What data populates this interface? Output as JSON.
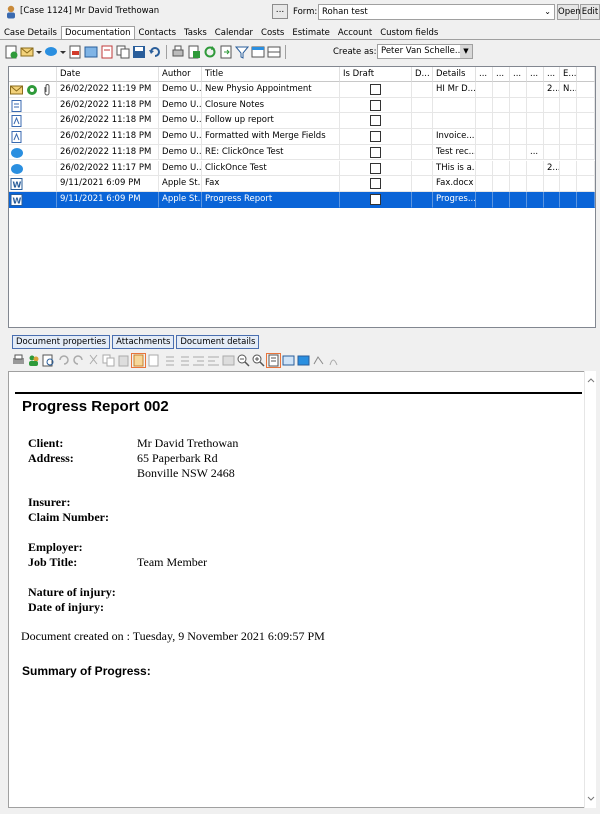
{
  "window": {
    "case_title": "[Case 1124] Mr David Trethowan",
    "more_label": "...",
    "form_label": "Form:",
    "form_value": "Rohan test",
    "open_label": "Open",
    "edit_label": "Edit"
  },
  "tabs": [
    "Case Details",
    "Documentation",
    "Contacts",
    "Tasks",
    "Calendar",
    "Costs",
    "Estimate",
    "Account",
    "Custom fields"
  ],
  "toolbar": {
    "create_as_label": "Create as:",
    "create_as_value": "Peter Van Schelle..."
  },
  "grid": {
    "headers": [
      "Date",
      "Author",
      "Title",
      "Is Draft",
      "D...",
      "Details",
      "...",
      "...",
      "...",
      "...",
      "...",
      "E..."
    ],
    "rows": [
      {
        "date": "26/02/2022 11:19 PM",
        "author": "Demo U...",
        "title": "New Physio Appointment",
        "details": "HI Mr D...",
        "c1": "",
        "c2": "",
        "c3": "",
        "c4": "",
        "c5": "2...",
        "c6": "N...",
        "selected": false
      },
      {
        "date": "26/02/2022 11:18 PM",
        "author": "Demo U...",
        "title": "Closure Notes",
        "details": "",
        "c1": "",
        "c2": "",
        "c3": "",
        "c4": "",
        "c5": "",
        "c6": "",
        "selected": false
      },
      {
        "date": "26/02/2022 11:18 PM",
        "author": "Demo U...",
        "title": "Follow up report",
        "details": "",
        "c1": "",
        "c2": "",
        "c3": "",
        "c4": "",
        "c5": "",
        "c6": "",
        "selected": false
      },
      {
        "date": "26/02/2022 11:18 PM",
        "author": "Demo U...",
        "title": "Formatted with Merge Fields",
        "details": "Invoice...",
        "c1": "",
        "c2": "",
        "c3": "",
        "c4": "",
        "c5": "",
        "c6": "",
        "selected": false
      },
      {
        "date": "26/02/2022 11:18 PM",
        "author": "Demo U...",
        "title": "RE: ClickOnce Test",
        "details": "Test rec...",
        "c1": "",
        "c2": "",
        "c3": "",
        "c4": "...",
        "c5": "",
        "c6": "",
        "selected": false
      },
      {
        "date": "26/02/2022 11:17 PM",
        "author": "Demo U...",
        "title": "ClickOnce Test",
        "details": "THis is a...",
        "c1": "",
        "c2": "",
        "c3": "",
        "c4": "",
        "c5": "2...",
        "c6": "",
        "selected": false
      },
      {
        "date": "9/11/2021 6:09 PM",
        "author": "Apple St...",
        "title": "Fax",
        "details": "Fax.docx",
        "c1": "",
        "c2": "",
        "c3": "",
        "c4": "",
        "c5": "",
        "c6": "",
        "selected": false
      },
      {
        "date": "9/11/2021 6:09 PM",
        "author": "Apple St...",
        "title": "Progress Report",
        "details": "Progres...",
        "c1": "",
        "c2": "",
        "c3": "",
        "c4": "",
        "c5": "",
        "c6": "",
        "selected": true
      }
    ]
  },
  "doc_tabs": [
    "Document properties",
    "Attachments",
    "Document details"
  ],
  "document": {
    "title": "Progress Report 002",
    "client_label": "Client:",
    "client_value": "Mr David Trethowan",
    "address_label": "Address:",
    "address_line1": "65 Paperbark Rd",
    "address_line2": "Bonville NSW 2468",
    "insurer_label": "Insurer:",
    "claim_label": "Claim Number:",
    "employer_label": "Employer:",
    "jobtitle_label": "Job Title:",
    "jobtitle_value": "Team Member",
    "injury_label": "Nature of injury:",
    "date_injury_label": "Date of injury:",
    "created": "Document created on : Tuesday, 9 November 2021 6:09:57 PM",
    "summary": "Summary of Progress:"
  },
  "colors": {
    "selection": "#0a64d7",
    "highlight": "#e8743b"
  }
}
